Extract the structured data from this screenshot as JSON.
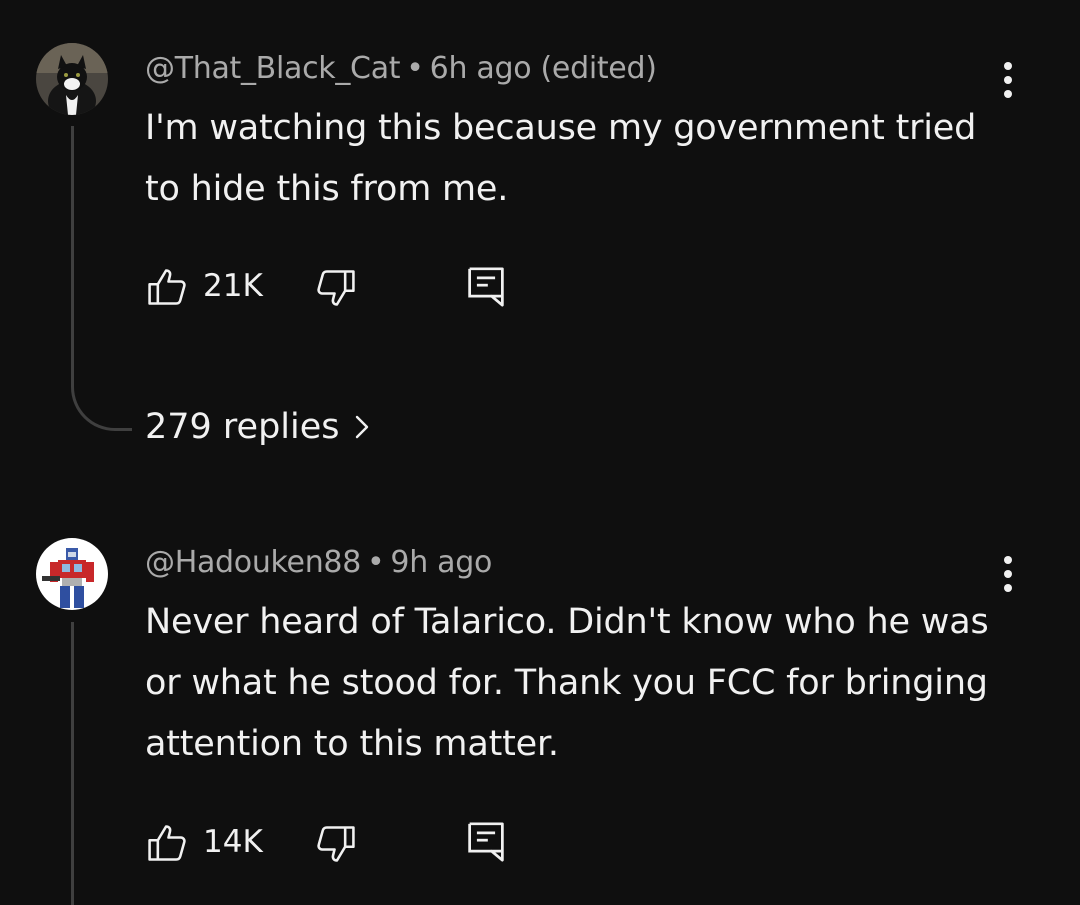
{
  "comments": [
    {
      "author": "@That_Black_Cat",
      "separator": "•",
      "time": "6h ago (edited)",
      "body": "I'm watching this because my government tried to hide this from me.",
      "likes": "21K",
      "replies_label": "279 replies",
      "avatar_icon": "black-white-cat-photo"
    },
    {
      "author": "@Hadouken88",
      "separator": "•",
      "time": "9h ago",
      "body": "Never heard of Talarico. Didn't know who he was or what he stood for. Thank you FCC for bringing attention to this matter.",
      "likes": "14K",
      "avatar_icon": "robot-character-avatar"
    }
  ],
  "colors": {
    "background": "#0f0f0f",
    "primary_text": "#f1f1f1",
    "secondary_text": "#aaaaaa",
    "thread_line": "#3f3f3f"
  }
}
